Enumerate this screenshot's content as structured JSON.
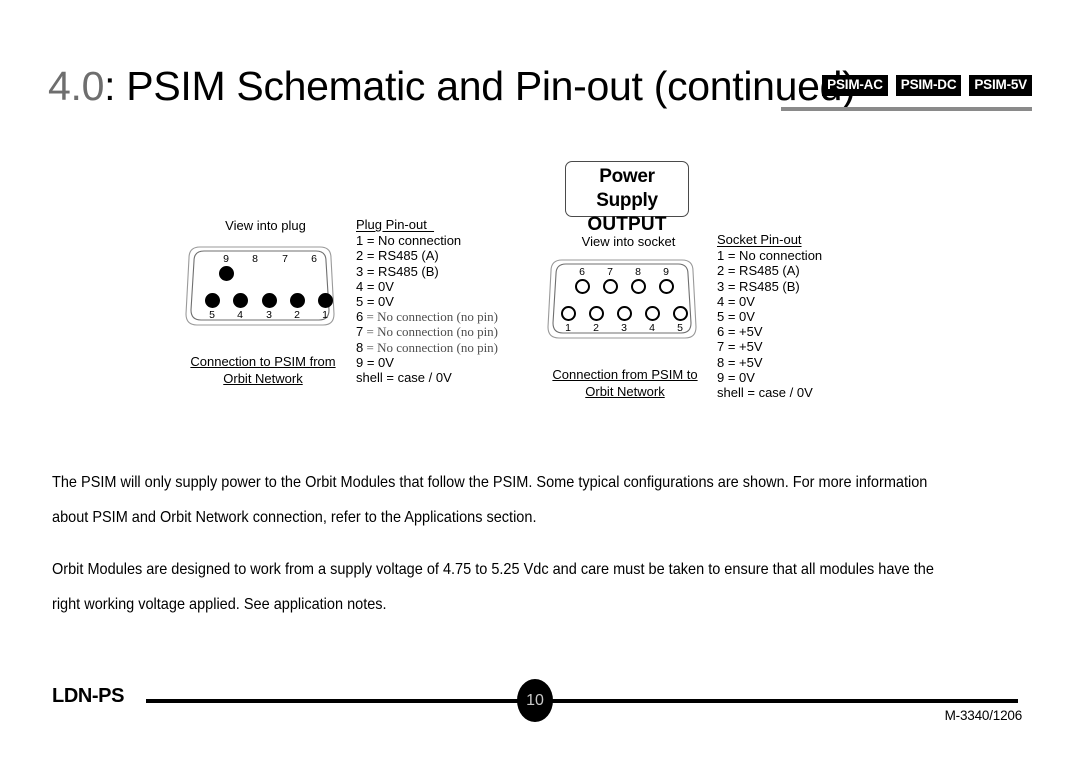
{
  "header": {
    "section_number": "4.0",
    "title": ": PSIM Schematic and Pin-out (continued)",
    "badges": [
      {
        "label": "PSIM-AC"
      },
      {
        "label": "PSIM-DC"
      },
      {
        "label": "PSIM-5V"
      }
    ],
    "rule_color": "#8a8a8a",
    "number_color": "#6e6e6e"
  },
  "psu_box": {
    "line1": "Power Supply",
    "line2": "OUTPUT"
  },
  "plug": {
    "view_label": "View into plug",
    "top_row_labels": [
      "9",
      "8",
      "7",
      "6"
    ],
    "top_row_pins_present": [
      true,
      false,
      false,
      false
    ],
    "bottom_row_labels": [
      "5",
      "4",
      "3",
      "2",
      "1"
    ],
    "bottom_row_pins_present": [
      true,
      true,
      true,
      true,
      true
    ],
    "pin_style": "filled",
    "caption_line1": "Connection to PSIM from",
    "caption_line2": " Orbit Network",
    "pinout_heading": "Plug Pin-out  ",
    "pinout_rows": [
      {
        "idx": "1",
        "text": " = No connection",
        "nopin": false
      },
      {
        "idx": "2",
        "text": " = RS485 (A)",
        "nopin": false
      },
      {
        "idx": "3",
        "text": " = RS485 (B)",
        "nopin": false
      },
      {
        "idx": "4",
        "text": " = 0V",
        "nopin": false
      },
      {
        "idx": "5",
        "text": " = 0V",
        "nopin": false
      },
      {
        "idx": "6",
        "text": " = No connection (no pin)",
        "nopin": true
      },
      {
        "idx": "7",
        "text": " = No connection (no pin)",
        "nopin": true
      },
      {
        "idx": "8",
        "text": " = No connection (no pin)",
        "nopin": true
      },
      {
        "idx": "9",
        "text": " = 0V",
        "nopin": false
      },
      {
        "idx": "shell",
        "text": " = case / 0V",
        "nopin": false
      }
    ]
  },
  "socket": {
    "view_label": "View into socket",
    "top_row_labels": [
      "6",
      "7",
      "8",
      "9"
    ],
    "bottom_row_labels": [
      "1",
      "2",
      "3",
      "4",
      "5"
    ],
    "pin_style": "hollow",
    "caption_line1": "Connection from PSIM to",
    "caption_line2": "Orbit Network",
    "pinout_heading": "Socket Pin-out",
    "pinout_rows": [
      {
        "idx": "1",
        "text": " = No connection",
        "nopin": false
      },
      {
        "idx": "2",
        "text": " = RS485 (A)",
        "nopin": false
      },
      {
        "idx": "3",
        "text": " = RS485 (B)",
        "nopin": false
      },
      {
        "idx": "4",
        "text": " = 0V",
        "nopin": false
      },
      {
        "idx": "5",
        "text": " = 0V",
        "nopin": false
      },
      {
        "idx": "6",
        "text": " = +5V",
        "nopin": false
      },
      {
        "idx": "7",
        "text": " = +5V",
        "nopin": false
      },
      {
        "idx": "8",
        "text": " = +5V",
        "nopin": false
      },
      {
        "idx": "9",
        "text": " = 0V",
        "nopin": false
      },
      {
        "idx": "shell",
        "text": " = case / 0V",
        "nopin": false
      }
    ]
  },
  "body": {
    "paragraph1": "The PSIM will only supply power to the Orbit Modules that follow the PSIM. Some typical configurations are shown. For more information about PSIM and Orbit Network connection, refer to the Applications section.",
    "paragraph2": "Orbit Modules are designed to work from a supply voltage of 4.75 to 5.25 Vdc and care must be taken to ensure that all modules have the right working voltage applied. See application notes."
  },
  "footer": {
    "product": "LDN-PS",
    "page_number": "10",
    "doc_number": "M-3340/1206"
  }
}
